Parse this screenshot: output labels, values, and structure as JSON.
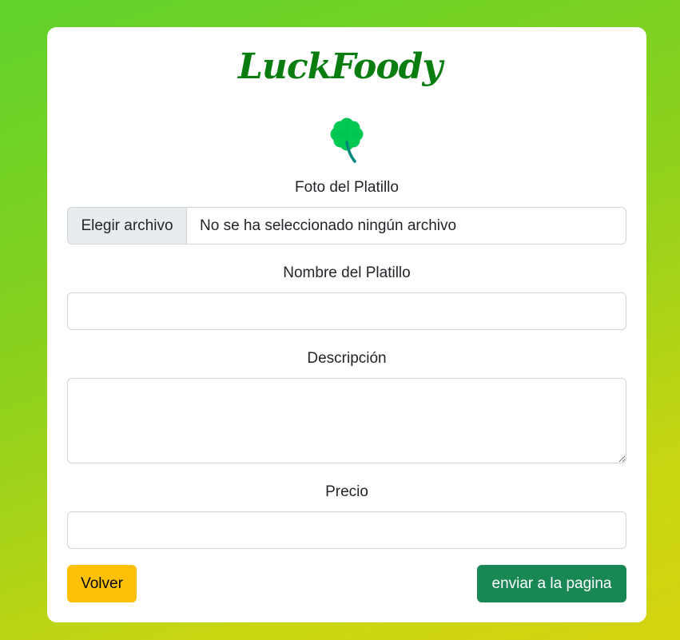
{
  "brand": {
    "name": "LuckFoody",
    "logo_icon": "four-leaf-clover-icon",
    "logo_color": "#00c853"
  },
  "form": {
    "photo": {
      "label": "Foto del Platillo",
      "button_label": "Elegir archivo",
      "status_text": "No se ha seleccionado ningún archivo"
    },
    "name": {
      "label": "Nombre del Platillo",
      "value": ""
    },
    "description": {
      "label": "Descripción",
      "value": ""
    },
    "price": {
      "label": "Precio",
      "value": ""
    }
  },
  "actions": {
    "back_label": "Volver",
    "submit_label": "enviar a la pagina"
  },
  "colors": {
    "brand": "#0a7d11",
    "back_button": "#ffc107",
    "submit_button": "#198754",
    "background_start": "#5fd22b",
    "background_end": "#d4d40f"
  }
}
